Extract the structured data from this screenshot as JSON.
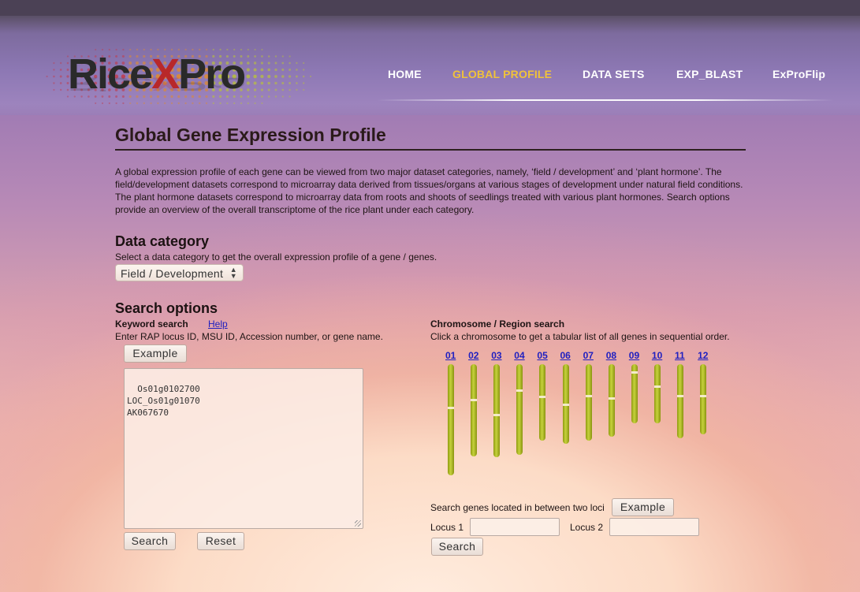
{
  "logo": {
    "part1": "Rice",
    "part2": "X",
    "part3": "Pro"
  },
  "nav": {
    "items": [
      {
        "label": "HOME",
        "active": false
      },
      {
        "label": "GLOBAL PROFILE",
        "active": true
      },
      {
        "label": "DATA SETS",
        "active": false
      },
      {
        "label": "EXP_BLAST",
        "active": false
      },
      {
        "label": "ExProFlip",
        "active": false
      }
    ]
  },
  "page": {
    "title": "Global Gene Expression Profile",
    "intro": "A global expression profile of each gene can be viewed from two major dataset categories, namely, ‘field / development’ and ‘plant hormone’. The field/development datasets correspond to microarray data derived from tissues/organs at various stages of development under natural field conditions. The plant hormone datasets correspond to microarray data from roots and shoots of seedlings treated with various plant hormones. Search options provide an overview of the overall transcriptome of the rice plant under each category."
  },
  "data_category": {
    "heading": "Data category",
    "description": "Select a data category to get the overall expression profile of a gene / genes.",
    "selected": "Field / Development"
  },
  "search_options": {
    "heading": "Search options",
    "keyword": {
      "title": "Keyword search",
      "help_label": "Help",
      "description": "Enter RAP locus ID, MSU ID, Accession number, or gene name.",
      "example_label": "Example",
      "text": "Os01g0102700\nLOC_Os01g01070\nAK067670",
      "search_label": "Search",
      "reset_label": "Reset"
    },
    "chromosome": {
      "title": "Chromosome / Region search",
      "description": "Click a chromosome to get a tabular list of all genes in sequential order.",
      "chromosomes": [
        {
          "label": "01",
          "length": 43.3,
          "centromere": 16.7
        },
        {
          "label": "02",
          "length": 35.9,
          "centromere": 13.6
        },
        {
          "label": "03",
          "length": 36.4,
          "centromere": 19.4
        },
        {
          "label": "04",
          "length": 35.5,
          "centromere": 9.7
        },
        {
          "label": "05",
          "length": 29.9,
          "centromere": 12.4
        },
        {
          "label": "06",
          "length": 31.2,
          "centromere": 15.4
        },
        {
          "label": "07",
          "length": 29.7,
          "centromere": 12.1
        },
        {
          "label": "08",
          "length": 28.4,
          "centromere": 12.9
        },
        {
          "label": "09",
          "length": 23.0,
          "centromere": 2.9
        },
        {
          "label": "10",
          "length": 23.2,
          "centromere": 8.2
        },
        {
          "label": "11",
          "length": 29.0,
          "centromere": 12.0
        },
        {
          "label": "12",
          "length": 27.5,
          "centromere": 11.9
        }
      ],
      "region_description": "Search genes located in between two loci",
      "region_example_label": "Example",
      "locus1_label": "Locus 1",
      "locus2_label": "Locus 2",
      "locus1_value": "",
      "locus2_value": "",
      "search_label": "Search"
    }
  },
  "colors": {
    "nav_active": "#f0c23a",
    "link": "#2020c0",
    "chromosome": "#b4c02a"
  }
}
